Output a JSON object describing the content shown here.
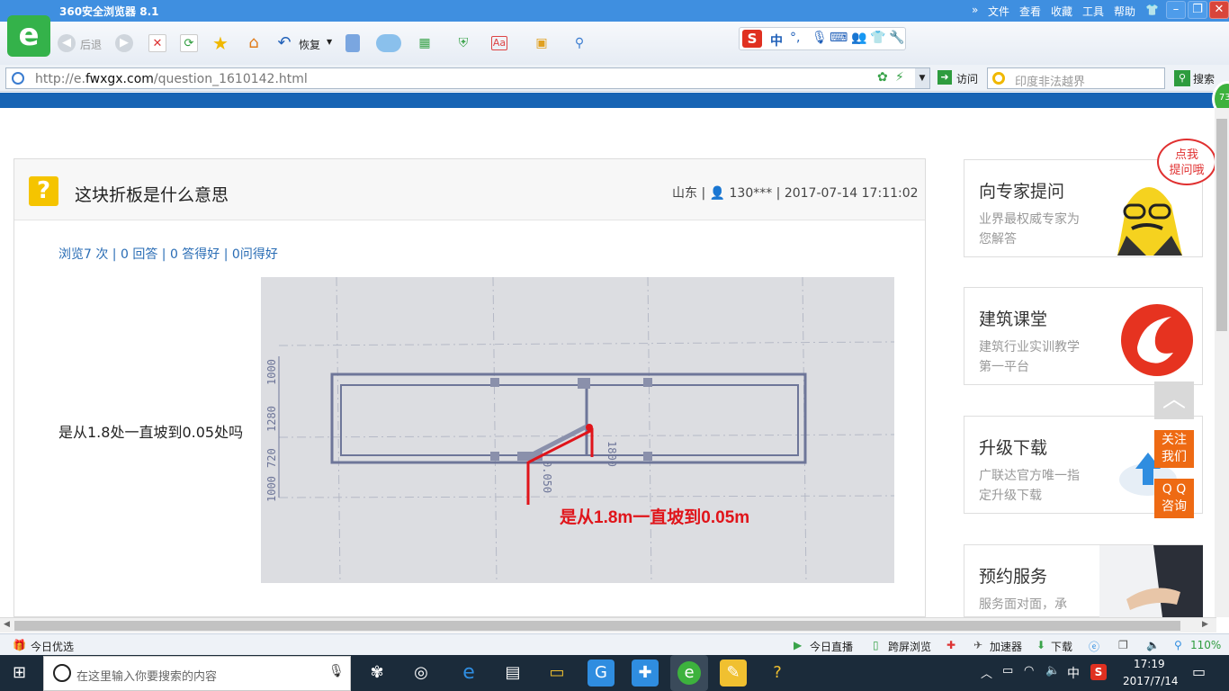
{
  "window": {
    "title": "360安全浏览器 8.1"
  },
  "menu": [
    "文件",
    "查看",
    "收藏",
    "工具",
    "帮助"
  ],
  "toolbar": {
    "back_label": "后退",
    "restore_label": "恢复"
  },
  "ime": {
    "chinese": "中"
  },
  "address": {
    "url_prefix": "http://e.",
    "url_domain": "fwxgx.com",
    "url_path": "/question_1610142.html",
    "visit_label": "访问"
  },
  "search": {
    "value": "印度非法越界",
    "button_label": "搜索"
  },
  "badge": "73",
  "question": {
    "title": "这块折板是什么意思",
    "meta": "山东 | 👤 130*** | 2017-07-14 17:11:02",
    "stats": "浏览7 次 | 0 回答 | 0 答得好 | 0问得好",
    "text": "是从1.8处一直坡到0.05处吗",
    "image_annotation": "是从1.8m一直坡到0.05m",
    "drawing_dims": {
      "d1": "1000",
      "d2": "1280",
      "d3": "1000",
      "d4": "720",
      "d5": "1800",
      "d6": "0.050"
    }
  },
  "sidebar": {
    "cards": [
      {
        "title": "向专家提问",
        "desc": "业界最权威专家为您解答"
      },
      {
        "title": "建筑课堂",
        "desc": "建筑行业实训教学第一平台"
      },
      {
        "title": "升级下载",
        "desc": "广联达官方唯一指定升级下载"
      },
      {
        "title": "预约服务",
        "desc": "服务面对面，承诺..."
      }
    ],
    "bubble": "点我\n提问哦",
    "follow": "关注\n我们",
    "qq": "Q Q\n咨询"
  },
  "status": {
    "today": "今日优选",
    "live": "今日直播",
    "cross": "跨屏浏览",
    "accel": "加速器",
    "download": "下载",
    "zoom": "110%"
  },
  "taskbar": {
    "search_placeholder": "在这里输入你要搜索的内容",
    "time": "17:19",
    "date": "2017/7/14",
    "ime": "中"
  }
}
